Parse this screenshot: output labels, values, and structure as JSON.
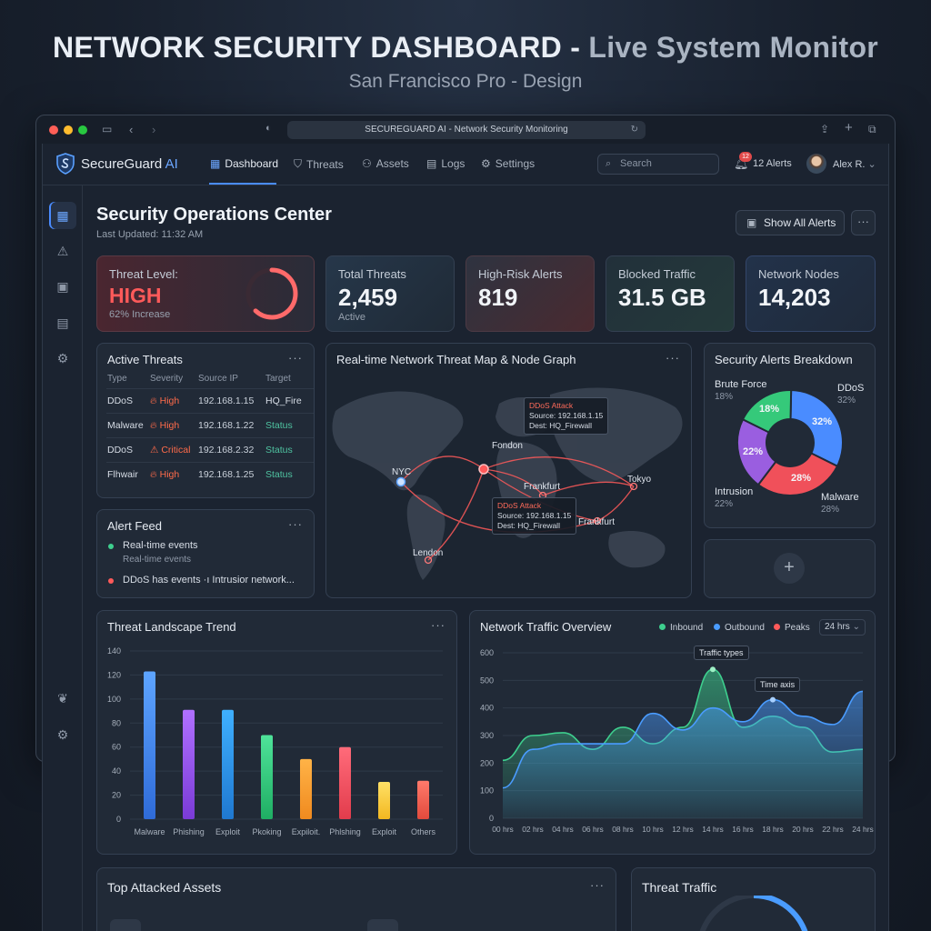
{
  "header": {
    "title_main": "NETWORK SECURITY DASHBOARD - ",
    "title_accent": "Live System Monitor",
    "subtitle": "San Francisco Pro - Design"
  },
  "browser": {
    "url": "SECUREGUARD AI - Network Security Monitoring",
    "dot_colors": [
      "#ff5f57",
      "#febc2e",
      "#28c840"
    ]
  },
  "nav": {
    "brand": "SecureGuard",
    "brand_ai": "AI",
    "items": [
      {
        "label": "Dashboard",
        "icon": "grid-icon"
      },
      {
        "label": "Threats",
        "icon": "shield-icon"
      },
      {
        "label": "Assets",
        "icon": "assets-icon"
      },
      {
        "label": "Logs",
        "icon": "document-icon"
      },
      {
        "label": "Settings",
        "icon": "gear-icon"
      }
    ],
    "search_placeholder": "Search",
    "alerts_badge": "12",
    "alerts_label": "12 Alerts",
    "user": "Alex R."
  },
  "page": {
    "title": "Security Operations Center",
    "updated": "Last Updated: 11:32 AM",
    "show_all_alerts": "Show All Alerts",
    "more": "···"
  },
  "kpis": {
    "threat_level": {
      "label": "Threat Level:",
      "value": "HIGH",
      "sub": "62% Increase",
      "gauge": 0.62
    },
    "total_threats": {
      "label": "Total Threats",
      "value": "2,459",
      "sub": "Active"
    },
    "high_risk": {
      "label": "High-Risk Alerts",
      "value": "819"
    },
    "blocked": {
      "label": "Blocked Traffic",
      "value": "31.5 GB"
    },
    "nodes": {
      "label": "Network Nodes",
      "value": "14,203"
    }
  },
  "active_threats": {
    "title": "Active Threats",
    "headers": [
      "Type",
      "Severity",
      "Source IP",
      "Target"
    ],
    "rows": [
      {
        "type": "DDoS",
        "severity": "High",
        "ip": "192.168.1.15",
        "target": "HQ_Fire"
      },
      {
        "type": "Malware",
        "severity": "High",
        "ip": "192.168.1.22",
        "target": "Status"
      },
      {
        "type": "DDoS",
        "severity": "Critical",
        "ip": "192.168.2.32",
        "target": "Status"
      },
      {
        "type": "Flhwair",
        "severity": "High",
        "ip": "192.168.1.25",
        "target": "Status"
      }
    ]
  },
  "alert_feed": {
    "title": "Alert Feed",
    "items": [
      {
        "text": "Real-time events",
        "sub": "Real-time events",
        "color": "#3ecf8e"
      },
      {
        "text": "DDoS has events ·ı Intrusior network...",
        "color": "#ff5a5a"
      }
    ]
  },
  "map": {
    "title": "Real-time Network Threat Map & Node Graph",
    "cities": [
      "NYC",
      "Fondon",
      "Frankfurt",
      "Tokyo",
      "Frankfurt",
      "Lendon"
    ],
    "tooltip1": {
      "title": "DDoS Attack",
      "source": "Source: 192.168.1.15",
      "dest": "Dest: HQ_Firewall"
    },
    "tooltip2": {
      "title": "DDoS Attack",
      "source": "Source: 192.168.1.15",
      "dest": "Dest: HQ_Firewall"
    }
  },
  "breakdown": {
    "title": "Security Alerts Breakdown",
    "slices": [
      {
        "name": "DDoS",
        "pct": "32%",
        "value": 32,
        "color": "#4a8cff"
      },
      {
        "name": "Malware",
        "pct": "28%",
        "value": 28,
        "color": "#f0505a"
      },
      {
        "name": "Intrusion",
        "pct": "22%",
        "value": 22,
        "color": "#9a5ee0"
      },
      {
        "name": "Brute Force",
        "pct": "18%",
        "value": 18,
        "color": "#35c97a"
      }
    ],
    "inner_labels": [
      "32%",
      "28%",
      "22%",
      "18%"
    ]
  },
  "trend": {
    "title": "Threat Landscape Trend",
    "chart_data": {
      "type": "bar",
      "categories": [
        "Malware",
        "Phishing",
        "Exploit",
        "Pkoking",
        "Expiloit.",
        "Phlshing",
        "Exploit",
        "Others"
      ],
      "values": [
        123,
        91,
        91,
        70,
        50,
        60,
        31,
        32
      ],
      "ylim": [
        0,
        140
      ],
      "yticks": [
        "140",
        "120",
        "100",
        "80",
        "60",
        "40",
        "20",
        "0"
      ],
      "colors": [
        [
          "#5da4ff",
          "#2f6bd8"
        ],
        [
          "#b070ff",
          "#7a3bd6"
        ],
        [
          "#3fb0ff",
          "#1f78d0"
        ],
        [
          "#4fe39a",
          "#1fae63"
        ],
        [
          "#ffb347",
          "#f08a1f"
        ],
        [
          "#ff6b7a",
          "#e23c4c"
        ],
        [
          "#ffe066",
          "#f2b820"
        ],
        [
          "#ff7a6b",
          "#e24a3c"
        ]
      ]
    }
  },
  "traffic": {
    "title": "Network Traffic Overview",
    "legend": [
      {
        "name": "Inbound",
        "color": "#3ecf8e"
      },
      {
        "name": "Outbound",
        "color": "#4a9cff"
      },
      {
        "name": "Peaks",
        "color": "#ff5a5a"
      }
    ],
    "range": "24 hrs",
    "tag1": "Traffic types",
    "tag2": "Time axis",
    "chart_data": {
      "type": "area",
      "x": [
        "00 hrs",
        "02 hrs",
        "04 hrs",
        "06 hrs",
        "08 hrs",
        "10 hrs",
        "12 hrs",
        "14 hrs",
        "16 hrs",
        "18 hrs",
        "20 hrs",
        "22 hrs",
        "24 hrs"
      ],
      "series": [
        {
          "name": "Inbound",
          "values": [
            210,
            300,
            310,
            250,
            330,
            270,
            330,
            540,
            330,
            370,
            330,
            240,
            250
          ]
        },
        {
          "name": "Outbound",
          "values": [
            110,
            250,
            270,
            270,
            270,
            380,
            320,
            400,
            350,
            430,
            370,
            340,
            460
          ]
        }
      ],
      "ylim": [
        0,
        600
      ],
      "yticks": [
        "600",
        "500",
        "400",
        "300",
        "200",
        "100",
        "0"
      ]
    }
  },
  "bottom": {
    "assets_title": "Top Attacked Assets",
    "traffic_title": "Threat Traffic"
  }
}
